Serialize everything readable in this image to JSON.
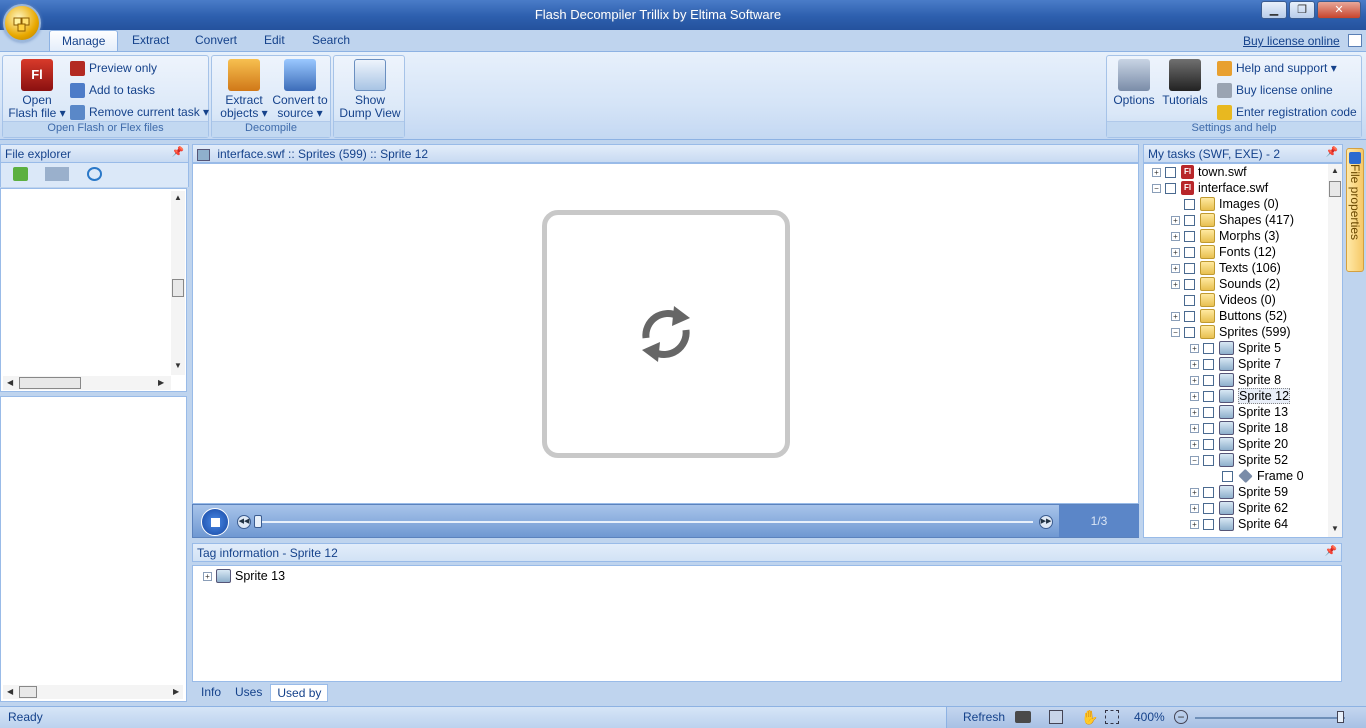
{
  "window": {
    "title": "Flash Decompiler Trillix by Eltima Software",
    "minimize": "▁",
    "maximize": "❐",
    "close": "✕"
  },
  "ribbon_tabs": [
    "Manage",
    "Extract",
    "Convert",
    "Edit",
    "Search"
  ],
  "buy_link": "Buy license online",
  "groups": {
    "open": {
      "label": "Open Flash or Flex files",
      "open_btn": [
        "Open",
        "Flash file ▾"
      ],
      "preview": "Preview only",
      "add": "Add to tasks",
      "remove": "Remove current task ▾"
    },
    "decompile": {
      "label": "Decompile",
      "extract": [
        "Extract",
        "objects ▾"
      ],
      "convert": [
        "Convert to",
        "source ▾"
      ]
    },
    "dump": {
      "show": [
        "Show",
        "Dump View"
      ]
    },
    "settings": {
      "label": "Settings and help",
      "options": "Options",
      "tutorials": "Tutorials",
      "help": "Help and support ▾",
      "buy": "Buy license online",
      "reg": "Enter registration code"
    }
  },
  "file_explorer": {
    "title": "File explorer"
  },
  "viewer": {
    "breadcrumb": "interface.swf :: Sprites (599) :: Sprite 12",
    "frame": "1/3"
  },
  "tasks": {
    "title": "My tasks (SWF, EXE) - 2",
    "side_tab": "File properties",
    "rows": [
      {
        "exp": "+",
        "label": "town.swf",
        "icon": "F",
        "level": 0
      },
      {
        "exp": "−",
        "label": "interface.swf",
        "icon": "F",
        "level": 0
      },
      {
        "exp": "",
        "label": "Images (0)",
        "icon": "folder",
        "level": 1
      },
      {
        "exp": "+",
        "label": "Shapes (417)",
        "icon": "folder",
        "level": 1
      },
      {
        "exp": "+",
        "label": "Morphs (3)",
        "icon": "folder",
        "level": 1
      },
      {
        "exp": "+",
        "label": "Fonts (12)",
        "icon": "folder",
        "level": 1
      },
      {
        "exp": "+",
        "label": "Texts (106)",
        "icon": "folder",
        "level": 1
      },
      {
        "exp": "+",
        "label": "Sounds (2)",
        "icon": "folder",
        "level": 1
      },
      {
        "exp": "",
        "label": "Videos (0)",
        "icon": "folder",
        "level": 1
      },
      {
        "exp": "+",
        "label": "Buttons (52)",
        "icon": "folder",
        "level": 1
      },
      {
        "exp": "−",
        "label": "Sprites (599)",
        "icon": "folder",
        "level": 1
      },
      {
        "exp": "+",
        "label": "Sprite 5",
        "icon": "sprite",
        "level": 2
      },
      {
        "exp": "+",
        "label": "Sprite 7",
        "icon": "sprite",
        "level": 2
      },
      {
        "exp": "+",
        "label": "Sprite 8",
        "icon": "sprite",
        "level": 2
      },
      {
        "exp": "+",
        "label": "Sprite 12",
        "icon": "sprite",
        "level": 2,
        "selected": true
      },
      {
        "exp": "+",
        "label": "Sprite 13",
        "icon": "sprite",
        "level": 2
      },
      {
        "exp": "+",
        "label": "Sprite 18",
        "icon": "sprite",
        "level": 2
      },
      {
        "exp": "+",
        "label": "Sprite 20",
        "icon": "sprite",
        "level": 2
      },
      {
        "exp": "−",
        "label": "Sprite 52",
        "icon": "sprite",
        "level": 2
      },
      {
        "exp": "",
        "label": "Frame 0",
        "icon": "frame",
        "level": 3
      },
      {
        "exp": "+",
        "label": "Sprite 59",
        "icon": "sprite",
        "level": 2
      },
      {
        "exp": "+",
        "label": "Sprite 62",
        "icon": "sprite",
        "level": 2
      },
      {
        "exp": "+",
        "label": "Sprite 64",
        "icon": "sprite",
        "level": 2
      }
    ]
  },
  "tag_info": {
    "title": "Tag information - Sprite 12",
    "item": "Sprite 13",
    "tabs": [
      "Info",
      "Uses",
      "Used by"
    ]
  },
  "status": {
    "text": "Ready",
    "refresh": "Refresh",
    "zoom": "400%"
  }
}
